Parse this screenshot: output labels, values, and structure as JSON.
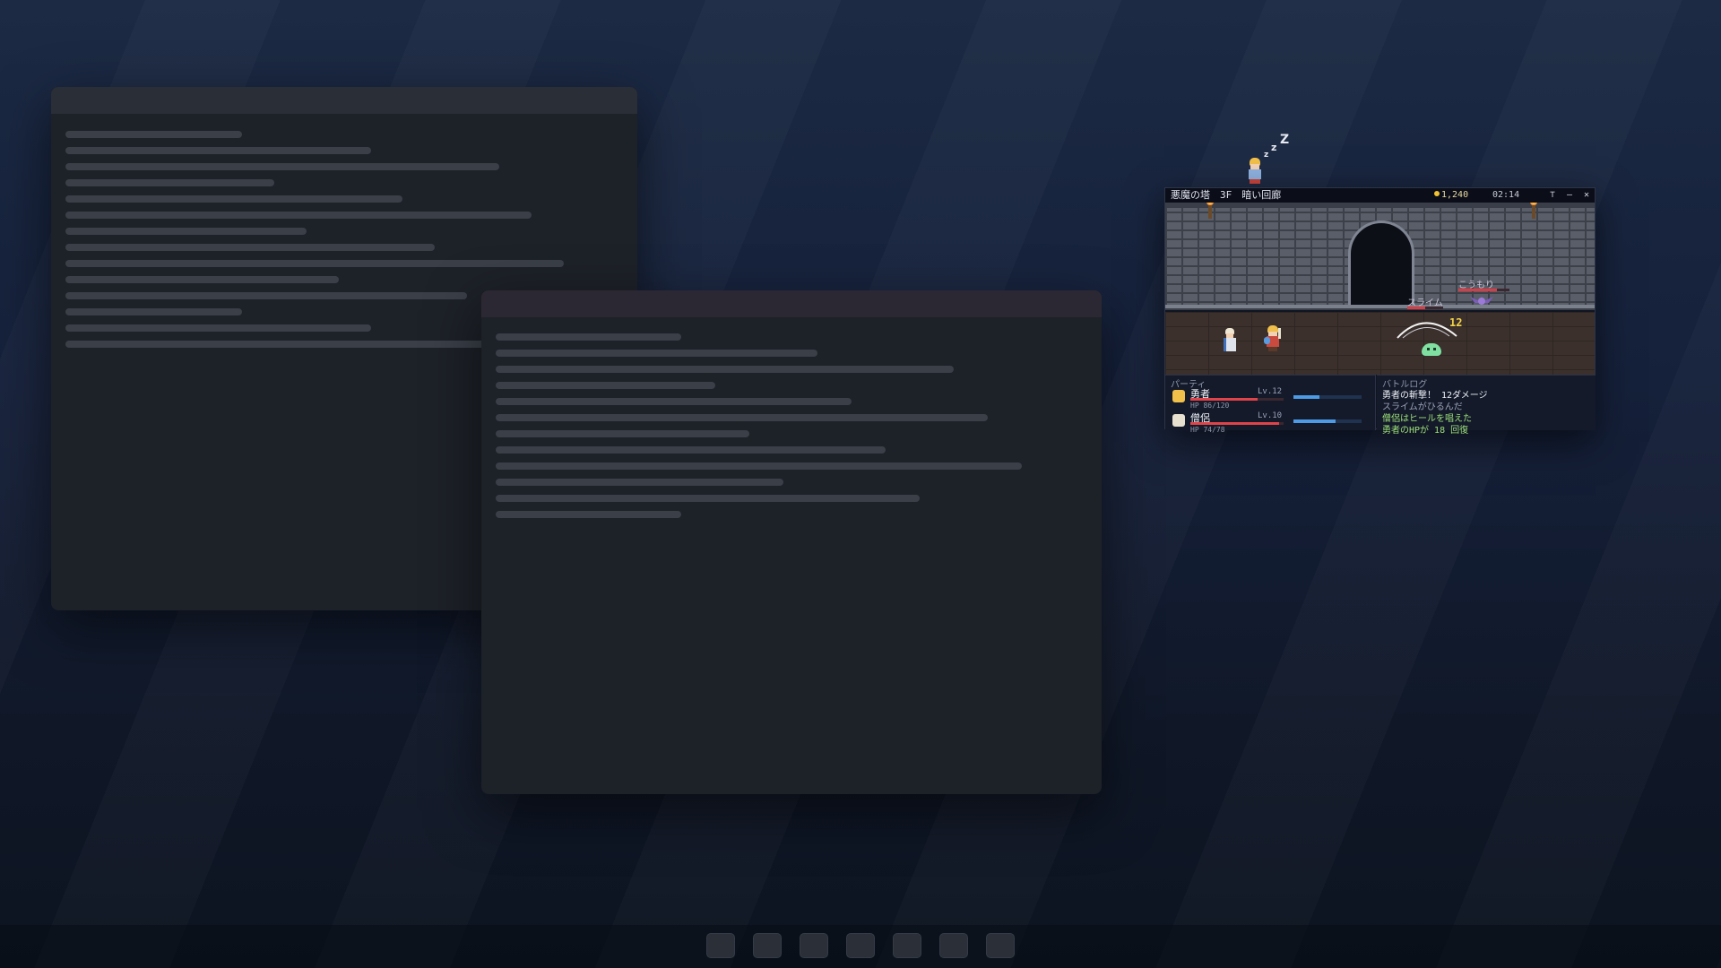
{
  "game": {
    "location": "悪魔の塔　3F　暗い回廊",
    "gold": "1,240",
    "time": "02:14",
    "controls": {
      "pin": "⊤",
      "minimize": "—",
      "close": "✕"
    },
    "enemies": [
      {
        "name": "こうもり",
        "hp_fraction": 0.75
      },
      {
        "name": "スライム",
        "hp_fraction": 0.5
      }
    ],
    "damage_popup": "12",
    "party": {
      "heading": "パーティ",
      "members": [
        {
          "name": "勇者",
          "level": "Lv.12",
          "hp_text": "HP 86/120",
          "hp_fraction": 0.72,
          "mp_fraction": 0.38,
          "face_color": "#f1c04a"
        },
        {
          "name": "僧侶",
          "level": "Lv.10",
          "hp_text": "HP 74/78",
          "hp_fraction": 0.95,
          "mp_fraction": 0.62,
          "face_color": "#e9e1cf"
        }
      ]
    },
    "battle_log": {
      "heading": "バトルログ",
      "entries": [
        {
          "text": "勇者の斬撃！ 12ダメージ",
          "color": "#eef1f8"
        },
        {
          "text": "スライムがひるんだ",
          "color": "#9aa2b6"
        },
        {
          "text": "僧侶はヒールを唱えた",
          "color": "#9de07a"
        },
        {
          "text": "勇者のHPが 18 回復",
          "color": "#9de07a"
        }
      ]
    }
  },
  "colors": {
    "hp": "#e0444a",
    "mp": "#4c9be4",
    "gold": "#f1c232",
    "damage": "#f2d34a"
  }
}
